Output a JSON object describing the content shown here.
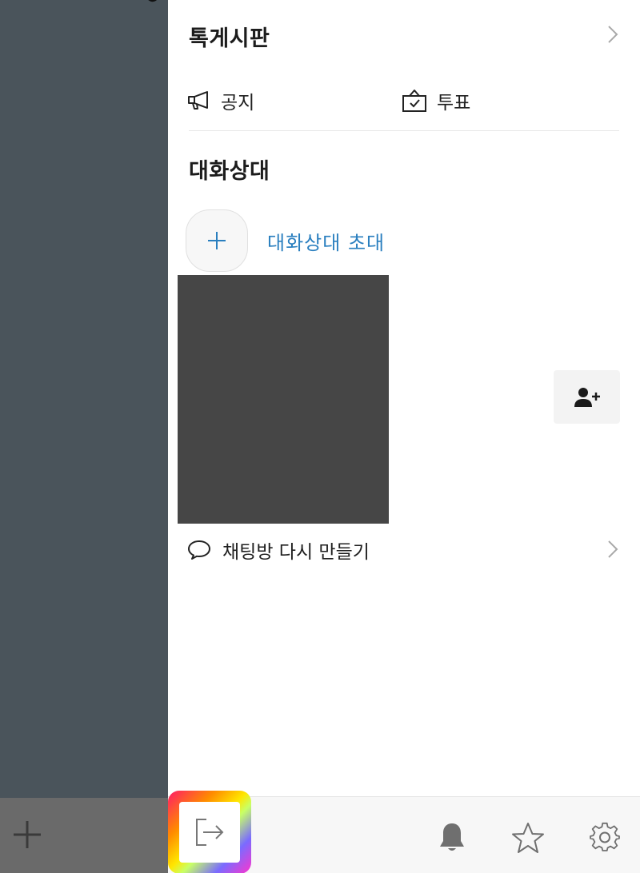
{
  "board": {
    "title": "톡게시판",
    "notice_label": "공지",
    "vote_label": "투표"
  },
  "members": {
    "title": "대화상대",
    "invite_label": "대화상대 초대"
  },
  "recreate": {
    "label": "채팅방 다시 만들기"
  },
  "bottom_bar": {
    "icons": [
      "leave-icon",
      "bell-icon",
      "star-icon",
      "gear-icon"
    ]
  },
  "colors": {
    "invite_blue": "#2a7fbf",
    "backdrop": "#4a545b",
    "drawer_bg": "#ffffff"
  }
}
